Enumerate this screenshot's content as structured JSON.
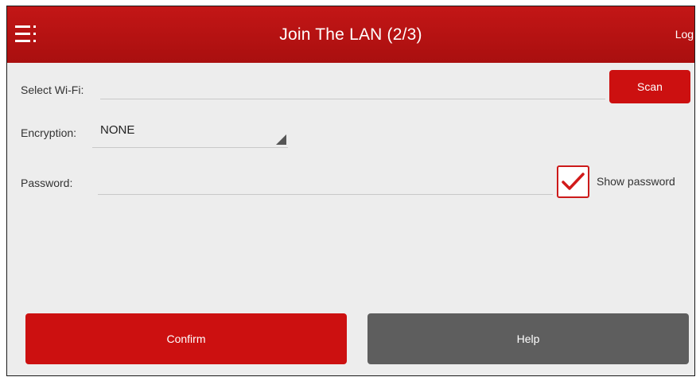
{
  "header": {
    "title": "Join The LAN (2/3)",
    "login_label": "Login"
  },
  "wifi": {
    "label": "Select Wi-Fi:",
    "value": "",
    "scan_label": "Scan"
  },
  "encryption": {
    "label": "Encryption:",
    "selected": "NONE"
  },
  "password": {
    "label": "Password:",
    "value": ""
  },
  "show_password": {
    "label": "Show password",
    "checked": true
  },
  "actions": {
    "confirm_label": "Confirm",
    "help_label": "Help"
  },
  "colors": {
    "accent": "#cc1010",
    "header_bg": "#b81212",
    "secondary_button": "#5e5e5e",
    "background": "#ededed"
  },
  "icons": {
    "menu": "menu-icon",
    "dropdown": "dropdown-triangle-icon",
    "checkmark": "checkmark-icon"
  }
}
